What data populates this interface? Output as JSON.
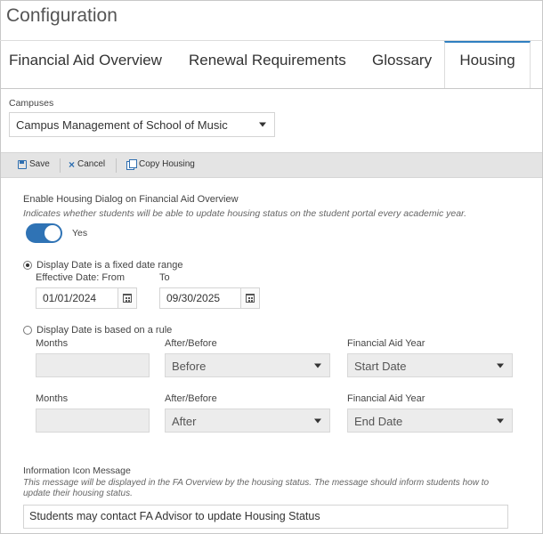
{
  "page": {
    "title": "Configuration"
  },
  "tabs": [
    {
      "label": "Financial Aid Overview"
    },
    {
      "label": "Renewal Requirements"
    },
    {
      "label": "Glossary"
    },
    {
      "label": "Housing"
    }
  ],
  "campuses": {
    "label": "Campuses",
    "selected": "Campus Management of School of Music"
  },
  "toolbar": {
    "save_label": "Save",
    "cancel_label": "Cancel",
    "copy_label": "Copy Housing"
  },
  "housing_dialog": {
    "label": "Enable Housing Dialog on Financial Aid Overview",
    "description": "Indicates whether students will be able to update housing status on the student portal every academic year.",
    "toggle_label": "Yes",
    "enabled": true
  },
  "fixed_range": {
    "label": "Display Date is a fixed date range",
    "from_label": "Effective Date: From",
    "to_label": "To",
    "from_value": "01/01/2024",
    "to_value": "09/30/2025",
    "selected": true
  },
  "rule": {
    "label": "Display Date is based on a rule",
    "selected": false,
    "rows": [
      {
        "months_label": "Months",
        "after_before_label": "After/Before",
        "after_before_value": "Before",
        "fa_year_label": "Financial Aid Year",
        "fa_year_value": "Start Date"
      },
      {
        "months_label": "Months",
        "after_before_label": "After/Before",
        "after_before_value": "After",
        "fa_year_label": "Financial Aid Year",
        "fa_year_value": "End Date"
      }
    ]
  },
  "info_message": {
    "label": "Information Icon Message",
    "description": "This message will be displayed in the FA Overview by the housing status. The message should inform students how to update their housing status.",
    "value": "Students may contact FA Advisor to update Housing Status"
  },
  "colors": {
    "accent": "#2f73b5",
    "toolbar_bg": "#e4e4e4"
  }
}
